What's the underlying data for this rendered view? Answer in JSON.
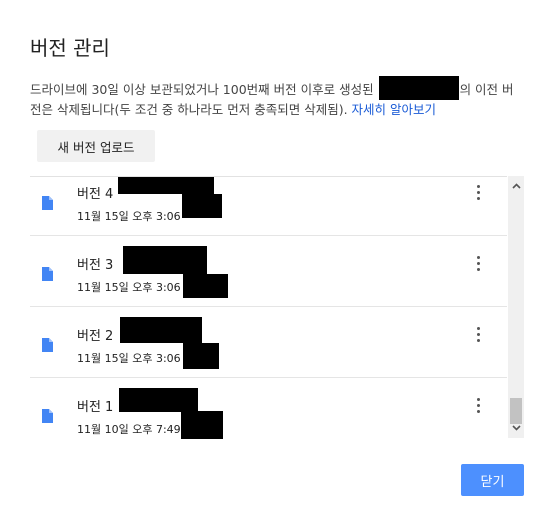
{
  "dialog": {
    "title": "버전 관리",
    "description_part1": "드라이브에 30일 이상 보관되었거나 100번째 버전 이후로 생성된 ",
    "description_part2": "의 이전 버전은 삭제됩니다(두 조건 중 하나라도 먼저 충족되면 삭제됨). ",
    "learn_more_link": "자세히 알아보기",
    "upload_button": "새 버전 업로드",
    "close_button": "닫기"
  },
  "versions": [
    {
      "label": "버전 4",
      "date": "11월 15일 오후 3:06"
    },
    {
      "label": "버전 3",
      "date": "11월 15일 오후 3:06"
    },
    {
      "label": "버전 2",
      "date": "11월 15일 오후 3:06"
    },
    {
      "label": "버전 1",
      "date": "11월 10일 오후 7:49"
    }
  ],
  "colors": {
    "primary_button": "#4d90fe",
    "link": "#1a5bd6",
    "file_icon": "#4285f4"
  },
  "icons": {
    "file": "file-icon",
    "more": "more-vert-icon",
    "scroll_up": "chevron-up-icon",
    "scroll_down": "chevron-down-icon"
  }
}
